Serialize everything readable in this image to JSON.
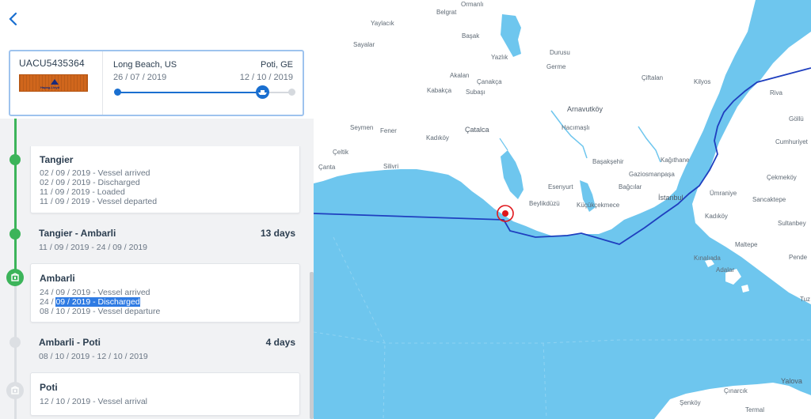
{
  "container": {
    "id": "UACU5435364",
    "logo_text": "Hapag-Lloyd",
    "origin": "Long Beach, US",
    "destination": "Poti, GE",
    "departure_date": "26 / 07 / 2019",
    "arrival_date": "12 / 10 / 2019",
    "progress_fraction": 0.83
  },
  "timeline": {
    "tangier": {
      "title": "Tangier",
      "events": [
        "02 / 09 / 2019 - Vessel arrived",
        "02 / 09 / 2019 - Discharged",
        "11 / 09 / 2019 - Loaded",
        "11 / 09 / 2019 - Vessel departed"
      ]
    },
    "leg1": {
      "title": "Tangier - Ambarli",
      "days": "13 days",
      "dates": "11 / 09 / 2019 - 24 / 09 / 2019"
    },
    "ambarli": {
      "title": "Ambarli",
      "event1": "24 / 09 / 2019 - Vessel arrived",
      "event2_prefix": "24 / ",
      "event2_highlight": "09 / 2019 - Discharged",
      "event3": "08 / 10 / 2019 - Vessel departure"
    },
    "leg2": {
      "title": "Ambarli - Poti",
      "days": "4 days",
      "dates": "08 / 10 / 2019 - 12 / 10 / 2019"
    },
    "poti": {
      "title": "Poti",
      "events": [
        "12 / 10 / 2019 - Vessel arrival"
      ]
    }
  },
  "colors": {
    "accent": "#1a6fd0",
    "done": "#3cb45a",
    "pending": "#dcdfe3",
    "sea": "#6ec6ee",
    "land": "#ffffff",
    "route": "#1f3fbf",
    "marker": "#e0161b"
  },
  "map": {
    "places": {
      "ormanli": "Ormanlı",
      "belgrat": "Belgrat",
      "yaylacik": "Yaylacık",
      "basak": "Başak",
      "sayalar": "Sayalar",
      "durusu": "Durusu",
      "yazlik": "Yazlık",
      "germe": "Germe",
      "ciftalan": "Çiftalan",
      "kilyos": "Kilyos",
      "riva": "Riva",
      "akalan": "Akalan",
      "canakca": "Çanakça",
      "kabakca": "Kabakça",
      "subasi": "Subaşı",
      "arnavutkoy": "Arnavutköy",
      "gollu": "Göllü",
      "hacimasli": "Hacımaşlı",
      "seymen": "Seymen",
      "fener": "Fener",
      "catalca": "Çatalca",
      "kadikoy1": "Kadıköy",
      "cumhuriyet": "Cumhuriyet",
      "celtik": "Çeltik",
      "canta": "Çanta",
      "silivri": "Silivri",
      "basaksehir": "Başakşehir",
      "kagithane": "Kağıthane",
      "gaziosmanpasa": "Gaziosmanpaşa",
      "cekmekoy": "Çekmeköy",
      "esenyurt": "Esenyurt",
      "bagcilar": "Bağcılar",
      "istanbul": "İstanbul",
      "umraniye": "Ümraniye",
      "sancaktepe": "Sancaktepe",
      "beylikduzu": "Beylikdüzü",
      "kucukcekmece": "Küçükçekmece",
      "kadikoy2": "Kadıköy",
      "sultanbeyli": "Sultanbey",
      "maltepe": "Maltepe",
      "pendik": "Pende",
      "kinaliada": "Kınalıada",
      "adalar": "Adalar",
      "tuz": "Tuz",
      "yalova": "Yalova",
      "cinarcik": "Çınarcık",
      "senkoy": "Şenköy",
      "termal": "Termal"
    }
  }
}
